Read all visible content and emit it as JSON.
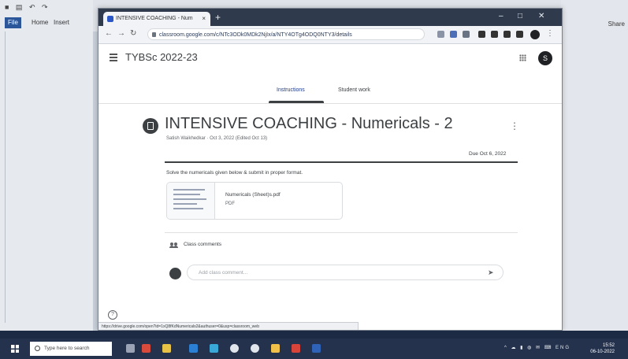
{
  "browser": {
    "tab_title": "INTENSIVE COACHING - Num",
    "tab_close": "×",
    "new_tab": "+",
    "url": "classroom.google.com/c/NTc3ODk0MDk2NjIx/a/NTY4OTg4ODQ0NTY3/details",
    "status_url": "https://drive.google.com/open?id=1xQ8fKdNumericals2&authuser=0&usp=classroom_web",
    "controls": {
      "back": "←",
      "forward": "→",
      "reload": "↻",
      "minimize": "–",
      "maximize": "□",
      "close": "✕"
    }
  },
  "classroom": {
    "class_name": "TYBSc 2022-23",
    "avatar_letter": "S",
    "tabs": [
      {
        "label": "Instructions"
      },
      {
        "label": "Student work"
      }
    ],
    "assignment": {
      "title": "INTENSIVE COACHING - Numericals - 2",
      "meta": "Satish Waikhedkar · Oct 3, 2022 (Edited Oct 13)",
      "due": "Due Oct 6, 2022",
      "description": "Solve the numericals given below & submit in proper format.",
      "attachment": {
        "name": "Numericals (Sheet)s.pdf",
        "type": "PDF"
      }
    },
    "comments": {
      "label": "Class comments",
      "placeholder": "Add class comment..."
    },
    "help": "?"
  },
  "desktop": {
    "tabs": [
      "File",
      "Home",
      "Insert"
    ],
    "share_label": "Share",
    "icons": "■ ▤ ↶ ↷"
  },
  "taskbar": {
    "search_placeholder": "Type here to search",
    "tray_icons": "^ ☁ ▮ ◍ ✉ ⌨ ENG",
    "time": "15:52",
    "date": "06-10-2022"
  }
}
